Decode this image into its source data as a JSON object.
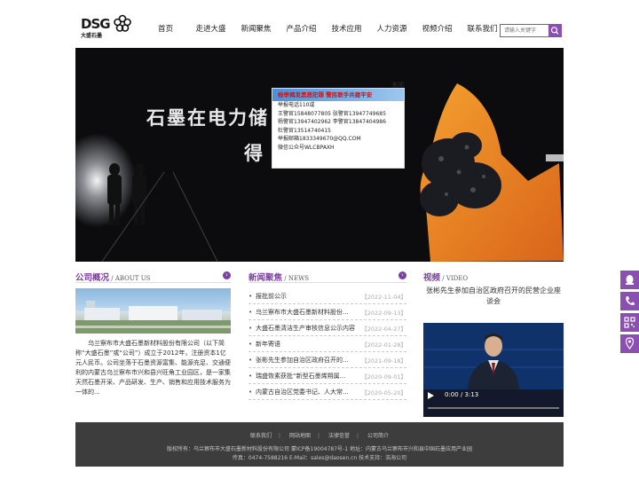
{
  "logo": {
    "text": "DSG",
    "sub": "大盛石墨"
  },
  "nav": [
    "首页",
    "走进大盛",
    "新闻聚焦",
    "产品介绍",
    "技术应用",
    "人力资源",
    "视频介绍",
    "联系我们"
  ],
  "search": {
    "placeholder": "请输入关键字"
  },
  "banner": {
    "title_line1": "石墨在电力储",
    "title_line2": "得",
    "popup": {
      "close": "关闭",
      "header": "检举揭发黑恶犯罪 警民联手共建平安",
      "lines": [
        "举报电话110或",
        "王警官15848077805  张警官13947749685",
        "杨警官13947402962  李警官13847404986",
        "杜警官13514740415",
        "举报邮箱1833349670@QQ.COM",
        "微信公众号WLCBPAXH"
      ]
    }
  },
  "about": {
    "title": "公司概况",
    "sub": "ABOUT US",
    "more": "›",
    "text": "乌兰察布市大盛石墨新材料股份有限公司（以下简称“大盛石墨”或“公司”）成立于2012年，注册资本1亿元人民币。公司坐落于石墨资源富集、能源充足、交通便利的内蒙古乌兰察布市兴和县兴旺角工业园区，是一家集天然石墨开采、产品研发、生产、销售和应用技术服务为一体的..."
  },
  "news": {
    "title": "新闻聚焦",
    "sub": "NEWS",
    "more": "›",
    "items": [
      {
        "title": "报批前公示",
        "date": "【2022-11-04】"
      },
      {
        "title": "乌兰察布市大盛石墨新材料股份...",
        "date": "【2022-09-13】"
      },
      {
        "title": "大盛石墨清洁生产审核信息公示内容",
        "date": "【2022-04-27】"
      },
      {
        "title": "新年寄语",
        "date": "【2022-01-28】"
      },
      {
        "title": "张彬先生参加自治区政府召开的...",
        "date": "【2021-09-18】"
      },
      {
        "title": "瑞盛恢素获批“新型石墨烯朔属...",
        "date": "【2020-09-01】"
      },
      {
        "title": "内蒙古自治区党委书记、人大常...",
        "date": "【2020-05-20】"
      }
    ]
  },
  "video": {
    "title": "视频",
    "sub": "VIDEO",
    "headline": "张彬先生参加自治区政府召开的民营企业座谈会",
    "time": "0:00 / 3:13"
  },
  "footer": {
    "links": [
      "联系我们",
      "网站地图",
      "法律信誉",
      "公司简介"
    ],
    "line1": "版权所有：乌兰察布市大盛石墨新材料股份有限公司   蒙ICP备19004787号-1     地址：内蒙古乌兰察布市兴和县中国石墨应用产业园",
    "line2": "传真：0474-7588216   E-Mail：sales@daosen.cn     技术支持：浩海公司"
  },
  "colors": {
    "accent": "#8a4fb0",
    "footer_bg": "#3d3d3d"
  }
}
